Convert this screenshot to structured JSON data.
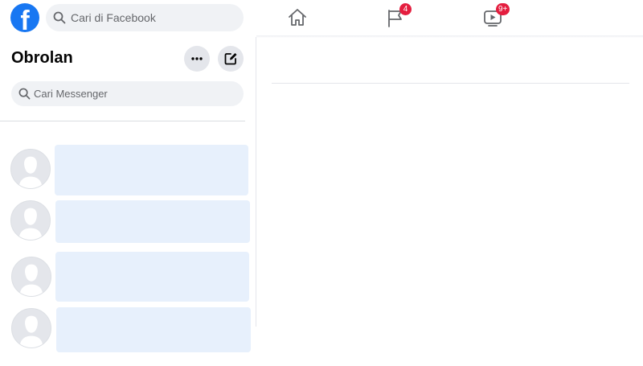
{
  "topbar": {
    "logo_icon": "facebook-logo-icon",
    "logo_letter": "f",
    "search_placeholder": "Cari di Facebook",
    "nav": [
      {
        "name": "home",
        "icon": "home-icon"
      },
      {
        "name": "pages",
        "icon": "flag-icon",
        "badge": "4"
      },
      {
        "name": "watch",
        "icon": "video-icon",
        "badge": "9+"
      }
    ]
  },
  "sidebar": {
    "title": "Obrolan",
    "more_icon": "more-icon",
    "compose_icon": "compose-icon",
    "search_placeholder": "Cari Messenger",
    "chats": [
      {
        "avatar_icon": "avatar-placeholder-icon"
      },
      {
        "avatar_icon": "avatar-placeholder-icon"
      },
      {
        "avatar_icon": "avatar-placeholder-icon"
      },
      {
        "avatar_icon": "avatar-placeholder-icon"
      }
    ]
  },
  "colors": {
    "brand": "#1877f2",
    "badge": "#e41e3f",
    "input_bg": "#f0f2f5",
    "loading_placeholder": "#e7f0fc"
  }
}
